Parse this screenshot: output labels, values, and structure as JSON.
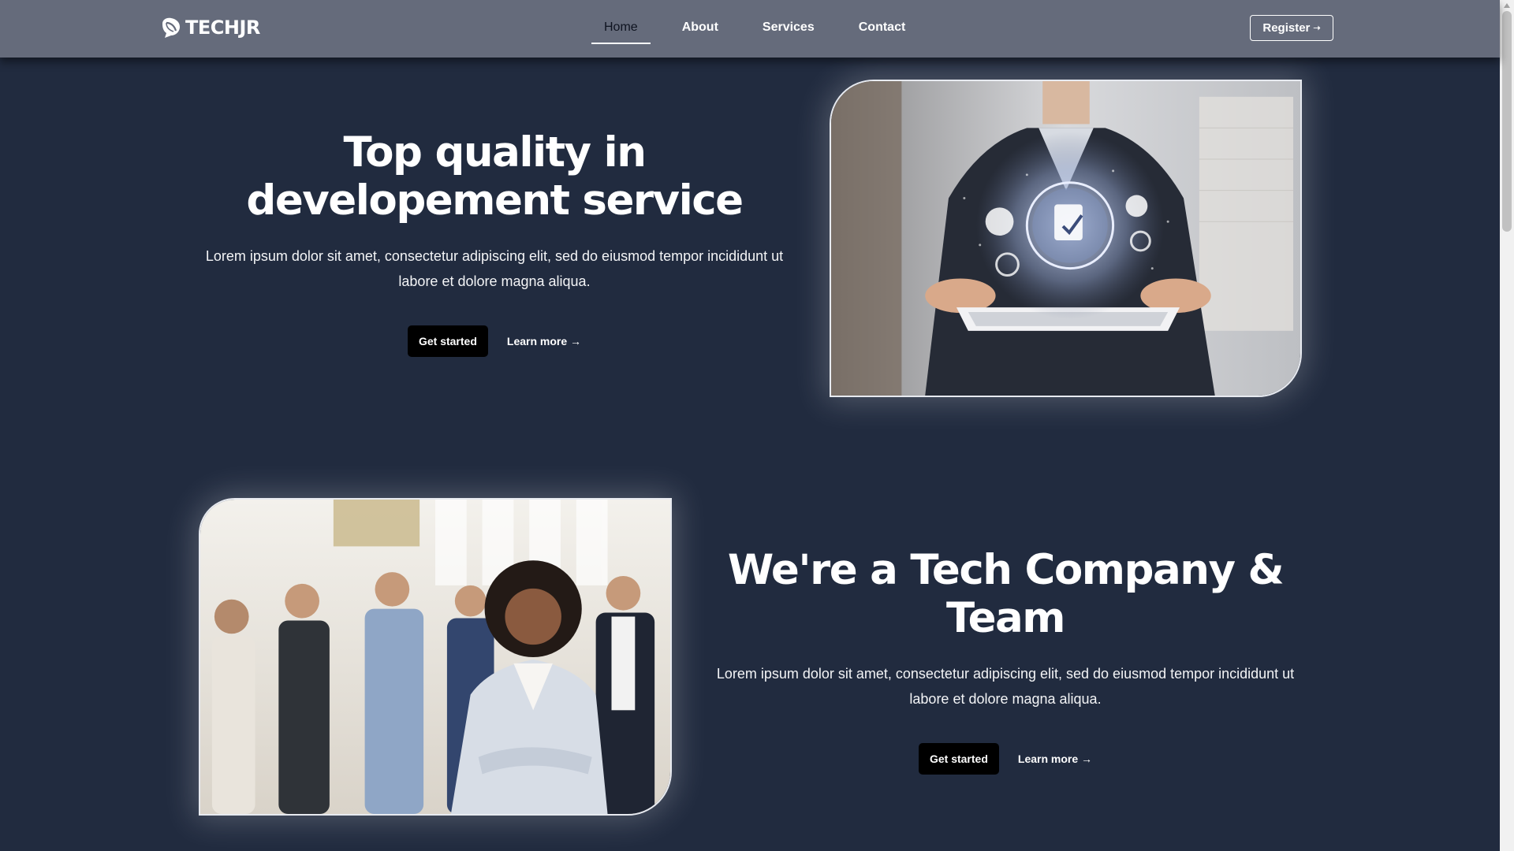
{
  "navbar": {
    "brand": "TECHJR",
    "links": [
      {
        "label": "Home",
        "active": true
      },
      {
        "label": "About",
        "active": false
      },
      {
        "label": "Services",
        "active": false
      },
      {
        "label": "Contact",
        "active": false
      }
    ],
    "register_label": "Register",
    "register_icon": "arrow-right-icon"
  },
  "hero": {
    "title_line1": "Top quality in",
    "title_line2": "developement service",
    "body": "Lorem ipsum dolor sit amet, consectetur adipiscing elit, sed do eiusmod tempor incididunt ut labore et dolore magna aliqua.",
    "get_started": "Get started",
    "learn_more": "Learn more →"
  },
  "about": {
    "title_line1": "We're a Tech Company &",
    "title_line2": "Team",
    "body": "Lorem ipsum dolor sit amet, consectetur adipiscing elit, sed do eiusmod tempor incididunt ut labore et dolore magna aliqua.",
    "get_started": "Get started",
    "learn_more": "Learn more →"
  },
  "colors": {
    "page_bg": "#212b3f",
    "navbar_bg": "#656b7b",
    "button_bg": "#000000",
    "text": "#ffffff"
  }
}
